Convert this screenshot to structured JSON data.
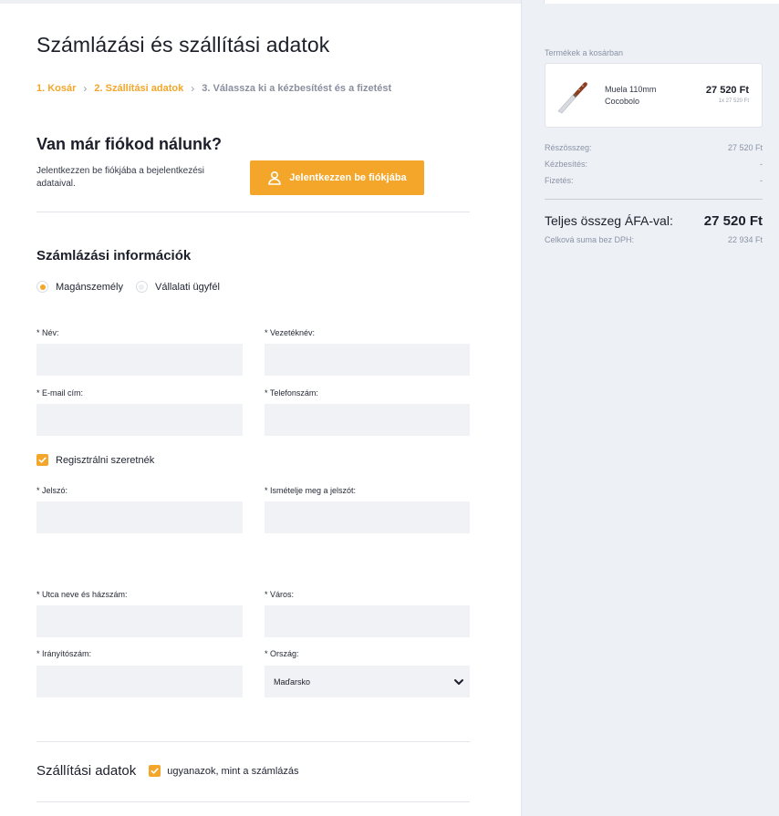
{
  "page": {
    "title": "Számlázási és szállítási adatok"
  },
  "breadcrumb": [
    {
      "label": "1. Kosár"
    },
    {
      "label": "2. Szállítási adatok"
    },
    {
      "label": "3. Válassza ki a kézbesítést és a fizetést"
    }
  ],
  "account": {
    "title": "Van már fiókod nálunk?",
    "description": "Jelentkezzen be fiókjába a bejelentkezési adataival.",
    "login_label": "Jelentkezzen be fiókjába"
  },
  "billing": {
    "title": "Számlázási információk",
    "customer_types": [
      {
        "label": "Magánszemély",
        "selected": true
      },
      {
        "label": "Vállalati ügyfél",
        "selected": false
      }
    ],
    "fields": {
      "first_name": {
        "label": "* Név:",
        "value": ""
      },
      "last_name": {
        "label": "* Vezetéknév:",
        "value": ""
      },
      "email": {
        "label": "* E-mail cím:",
        "value": ""
      },
      "phone": {
        "label": "* Telefonszám:",
        "value": ""
      },
      "password": {
        "label": "* Jelszó:",
        "value": ""
      },
      "password_repeat": {
        "label": "* Ismételje meg a jelszót:",
        "value": ""
      },
      "street": {
        "label": "* Utca neve és házszám:",
        "value": ""
      },
      "city": {
        "label": "* Város:",
        "value": ""
      },
      "zip": {
        "label": "* Irányítószám:",
        "value": ""
      },
      "country": {
        "label": "* Ország:",
        "value": "Maďarsko"
      }
    },
    "register": {
      "label": "Regisztrálni szeretnék",
      "checked": true
    }
  },
  "shipping": {
    "title": "Szállítási adatok",
    "same_as_billing": {
      "label": "ugyanazok, mint a számlázás",
      "checked": true
    }
  },
  "cart": {
    "caption": "Termékek a kosárban",
    "item": {
      "name_line1": "Muela 110mm",
      "name_line2": "Cocobolo",
      "price": "27 520 Ft",
      "unit": "1x 27 520 Ft"
    },
    "summary": {
      "subtotal_label": "Részösszeg:",
      "subtotal_value": "27 520 Ft",
      "delivery_label": "Kézbesítés:",
      "delivery_value": "-",
      "payment_label": "Fizetés:",
      "payment_value": "-",
      "total_label": "Teljes összeg ÁFA-val:",
      "total_value": "27 520 Ft",
      "net_label": "Celková suma bez DPH:",
      "net_value": "22 934 Ft"
    }
  },
  "colors": {
    "accent": "#f4a62a",
    "field_bg": "#f0f2f6",
    "sidebar_bg": "#edf0f5"
  }
}
